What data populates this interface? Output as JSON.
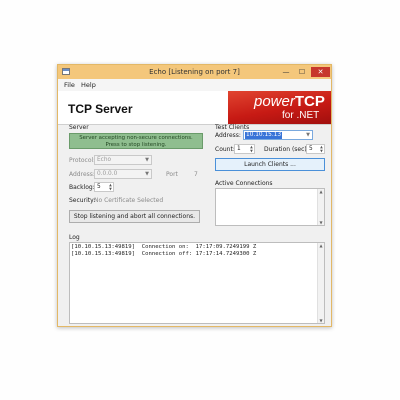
{
  "window": {
    "title": "Echo [Listening on port 7]",
    "controls": {
      "minimize": "—",
      "maximize": "☐",
      "close": "✕"
    }
  },
  "menu": {
    "file": "File",
    "help": "Help"
  },
  "banner": {
    "title": "TCP Server",
    "logo": {
      "power": "power",
      "tcp": "TCP",
      "sub": "for .NET"
    }
  },
  "server": {
    "group_label": "Server",
    "status_line1": "Server accepting non-secure connections.",
    "status_line2": "Press to stop listening.",
    "protocol_label": "Protocol:",
    "protocol_value": "Echo",
    "address_label": "Address:",
    "address_value": "0.0.0.0",
    "port_label": "Port",
    "port_value": "7",
    "backlog_label": "Backlog:",
    "backlog_value": "5",
    "security_label": "Security:",
    "security_value": "No Certificate Selected",
    "stop_button": "Stop listening and abort all connections."
  },
  "test_clients": {
    "group_label": "Test Clients",
    "address_label": "Address:",
    "address_value": "10.10.15.13",
    "count_label": "Count:",
    "count_value": "1",
    "duration_label": "Duration (sec):",
    "duration_value": "5",
    "launch_button": "Launch Clients ..."
  },
  "active_connections": {
    "label": "Active Connections"
  },
  "log": {
    "label": "Log",
    "lines": [
      "[10.10.15.13:49819]  Connection on:  17:17:09.7249199 Z",
      "[10.10.15.13:49819]  Connection off: 17:17:14.7249300 Z"
    ]
  }
}
